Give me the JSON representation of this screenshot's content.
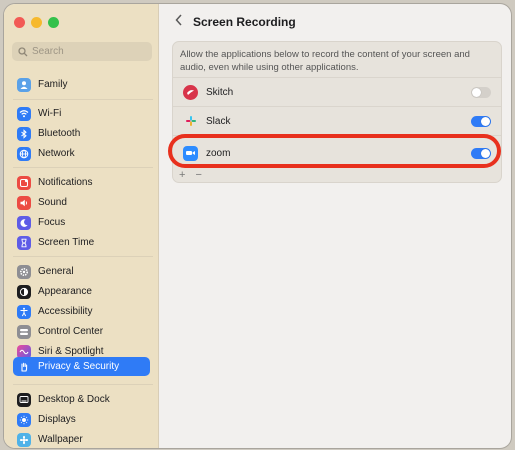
{
  "window": {
    "traffic_colors": [
      "#f25a55",
      "#f6b92e",
      "#34c14b"
    ]
  },
  "sidebar": {
    "search_placeholder": "Search",
    "items": [
      {
        "label": "Family",
        "icon": "family-icon",
        "color": "#5aa1e8"
      },
      {
        "label": "Wi-Fi",
        "icon": "wifi-icon",
        "color": "#2f7bf6"
      },
      {
        "label": "Bluetooth",
        "icon": "bluetooth-icon",
        "color": "#2f7bf6"
      },
      {
        "label": "Network",
        "icon": "network-icon",
        "color": "#2f7bf6"
      },
      {
        "label": "Notifications",
        "icon": "notifications-icon",
        "color": "#ec4b43"
      },
      {
        "label": "Sound",
        "icon": "sound-icon",
        "color": "#ec4b43"
      },
      {
        "label": "Focus",
        "icon": "focus-icon",
        "color": "#5e5ce6"
      },
      {
        "label": "Screen Time",
        "icon": "screen-time-icon",
        "color": "#5e5ce6"
      },
      {
        "label": "General",
        "icon": "general-icon",
        "color": "#8e8e93"
      },
      {
        "label": "Appearance",
        "icon": "appearance-icon",
        "color": "#1d1d1f"
      },
      {
        "label": "Accessibility",
        "icon": "accessibility-icon",
        "color": "#2f7bf6"
      },
      {
        "label": "Control Center",
        "icon": "control-center-icon",
        "color": "#8e8e93"
      },
      {
        "label": "Siri & Spotlight",
        "icon": "siri-icon",
        "color": "#b64ed8"
      },
      {
        "label": "Privacy & Security",
        "icon": "privacy-hand-icon",
        "color": "#2f7bf6",
        "selected": true
      },
      {
        "label": "Desktop & Dock",
        "icon": "desktop-dock-icon",
        "color": "#1d1d1f"
      },
      {
        "label": "Displays",
        "icon": "displays-icon",
        "color": "#2f7bf6"
      },
      {
        "label": "Wallpaper",
        "icon": "wallpaper-icon",
        "color": "#4fb2e8"
      }
    ]
  },
  "main": {
    "title": "Screen Recording",
    "description": "Allow the applications below to record the content of your screen and audio, even while using other applications.",
    "apps": [
      {
        "name": "Skitch",
        "icon": "skitch-icon",
        "enabled": false
      },
      {
        "name": "Slack",
        "icon": "slack-icon",
        "enabled": true
      },
      {
        "name": "zoom",
        "icon": "zoom-icon",
        "enabled": true
      }
    ],
    "add_label": "+",
    "remove_label": "−"
  },
  "accent": "#2f7bf6",
  "highlight_color": "#e8301d"
}
